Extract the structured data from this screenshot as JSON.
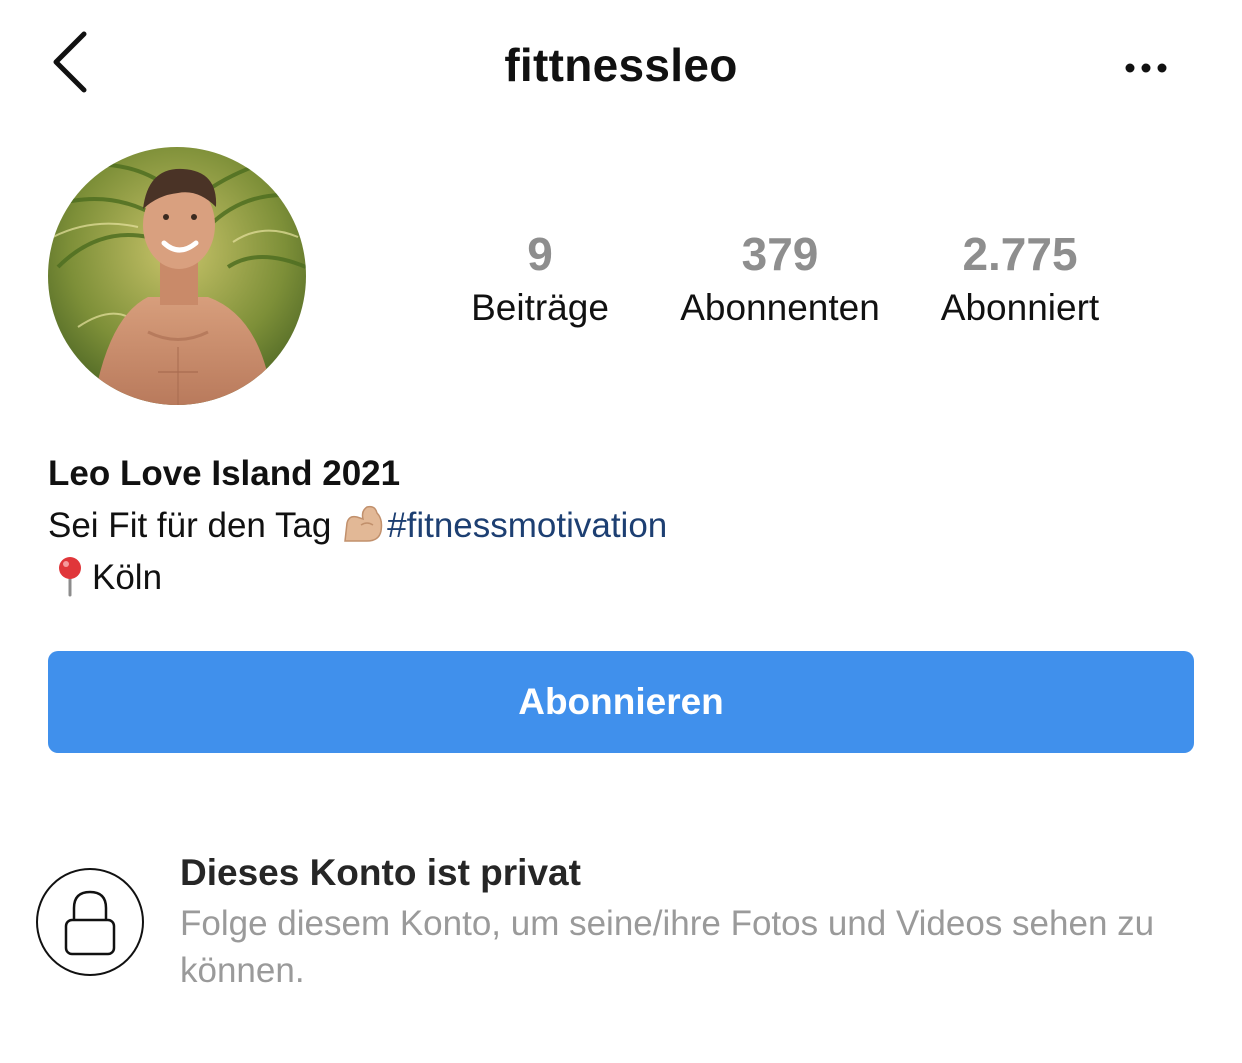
{
  "nav": {
    "title": "fittnessleo",
    "back_icon": "chevron-left-icon",
    "more_icon": "more-horizontal-icon"
  },
  "profile": {
    "avatar_description": "profile-photo",
    "stats": [
      {
        "value": "9",
        "label": "Beiträge"
      },
      {
        "value": "379",
        "label": "Abonnenten"
      },
      {
        "value": "2.775",
        "label": "Abonniert"
      }
    ],
    "name": "Leo Love Island 2021",
    "bio_text": "Sei Fit für den Tag ",
    "bio_emoji": "flexed-biceps-icon",
    "hashtag": "#fitnessmotivation",
    "location_icon": "pushpin-icon",
    "location": "Köln"
  },
  "actions": {
    "follow_label": "Abonnieren"
  },
  "private": {
    "icon": "lock-icon",
    "title": "Dieses Konto ist privat",
    "description": "Folge diesem Konto, um seine/ihre Fotos und Videos sehen zu können."
  },
  "colors": {
    "accent": "#4090ec",
    "hashtag": "#1d3f72",
    "secondary_text": "#9a9a9a",
    "stat_number": "#8e8e8e"
  }
}
